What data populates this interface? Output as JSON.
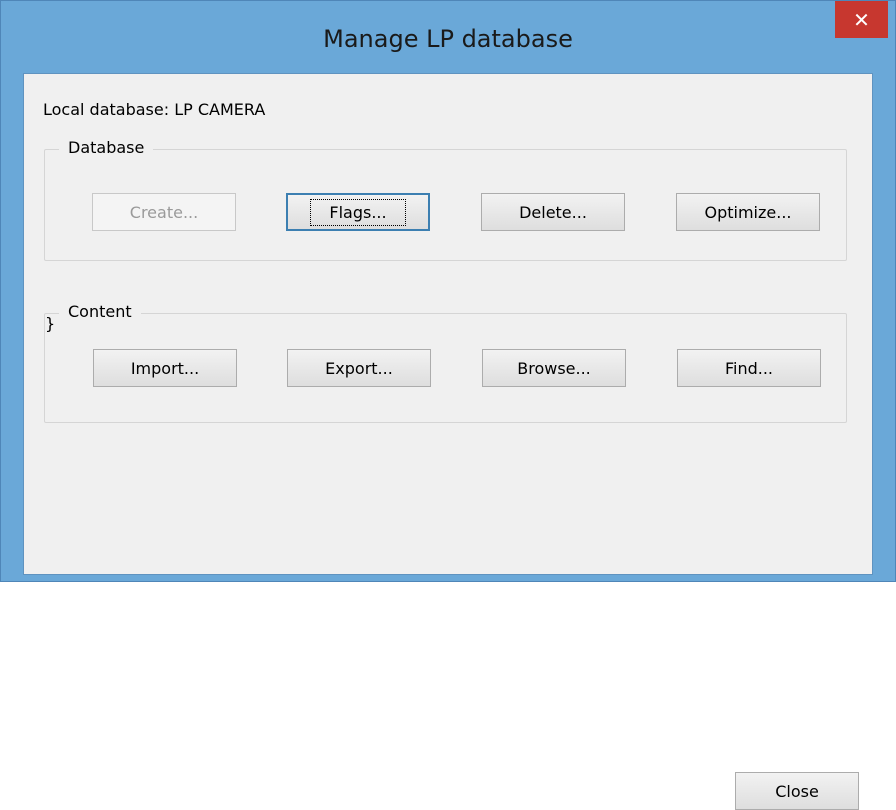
{
  "window": {
    "title": "Manage LP database",
    "close_label": "✕"
  },
  "local_db": "Local database: LP CAMERA",
  "database_group": {
    "legend": "Database",
    "buttons": [
      {
        "label": "Create...",
        "state": "disabled"
      },
      {
        "label": "Flags...",
        "state": "focused"
      },
      {
        "label": "Delete...",
        "state": "normal"
      },
      {
        "label": "Optimize...",
        "state": "normal"
      }
    ]
  },
  "content_group": {
    "legend": "Content",
    "buttons": [
      {
        "label": "Import...",
        "state": "normal"
      },
      {
        "label": "Export...",
        "state": "normal"
      },
      {
        "label": "Browse...",
        "state": "normal"
      },
      {
        "label": "Find...",
        "state": "normal"
      }
    ]
  },
  "close_button": "Close",
  "colors": {
    "titlebar": "#6aa8d8",
    "close_button_bg": "#c7372f",
    "client_bg": "#f0f0f0",
    "focus_border": "#3c7fb1"
  }
}
